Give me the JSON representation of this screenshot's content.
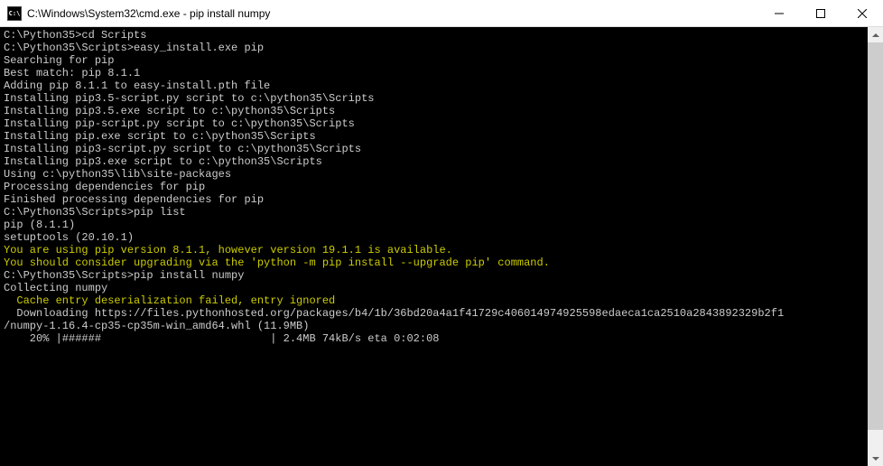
{
  "titlebar": {
    "icon_label": "C:\\",
    "title": "C:\\Windows\\System32\\cmd.exe - pip  install numpy"
  },
  "terminal": {
    "lines": [
      {
        "text": "",
        "cls": ""
      },
      {
        "text": "C:\\Python35>cd Scripts",
        "cls": ""
      },
      {
        "text": "",
        "cls": ""
      },
      {
        "text": "C:\\Python35\\Scripts>easy_install.exe pip",
        "cls": ""
      },
      {
        "text": "Searching for pip",
        "cls": ""
      },
      {
        "text": "Best match: pip 8.1.1",
        "cls": ""
      },
      {
        "text": "Adding pip 8.1.1 to easy-install.pth file",
        "cls": ""
      },
      {
        "text": "Installing pip3.5-script.py script to c:\\python35\\Scripts",
        "cls": ""
      },
      {
        "text": "Installing pip3.5.exe script to c:\\python35\\Scripts",
        "cls": ""
      },
      {
        "text": "Installing pip-script.py script to c:\\python35\\Scripts",
        "cls": ""
      },
      {
        "text": "Installing pip.exe script to c:\\python35\\Scripts",
        "cls": ""
      },
      {
        "text": "Installing pip3-script.py script to c:\\python35\\Scripts",
        "cls": ""
      },
      {
        "text": "Installing pip3.exe script to c:\\python35\\Scripts",
        "cls": ""
      },
      {
        "text": "",
        "cls": ""
      },
      {
        "text": "Using c:\\python35\\lib\\site-packages",
        "cls": ""
      },
      {
        "text": "Processing dependencies for pip",
        "cls": ""
      },
      {
        "text": "Finished processing dependencies for pip",
        "cls": ""
      },
      {
        "text": "",
        "cls": ""
      },
      {
        "text": "C:\\Python35\\Scripts>pip list",
        "cls": ""
      },
      {
        "text": "pip (8.1.1)",
        "cls": ""
      },
      {
        "text": "setuptools (20.10.1)",
        "cls": ""
      },
      {
        "text": "You are using pip version 8.1.1, however version 19.1.1 is available.",
        "cls": "yellow"
      },
      {
        "text": "You should consider upgrading via the 'python -m pip install --upgrade pip' command.",
        "cls": "yellow"
      },
      {
        "text": "",
        "cls": ""
      },
      {
        "text": "C:\\Python35\\Scripts>pip install numpy",
        "cls": ""
      },
      {
        "text": "Collecting numpy",
        "cls": ""
      },
      {
        "text": "  Cache entry deserialization failed, entry ignored",
        "cls": "yellow"
      },
      {
        "text": "  Downloading https://files.pythonhosted.org/packages/b4/1b/36bd20a4a1f41729c406014974925598edaeca1ca2510a2843892329b2f1",
        "cls": ""
      },
      {
        "text": "/numpy-1.16.4-cp35-cp35m-win_amd64.whl (11.9MB)",
        "cls": ""
      },
      {
        "text": "    20% |######                          | 2.4MB 74kB/s eta 0:02:08",
        "cls": ""
      }
    ]
  }
}
